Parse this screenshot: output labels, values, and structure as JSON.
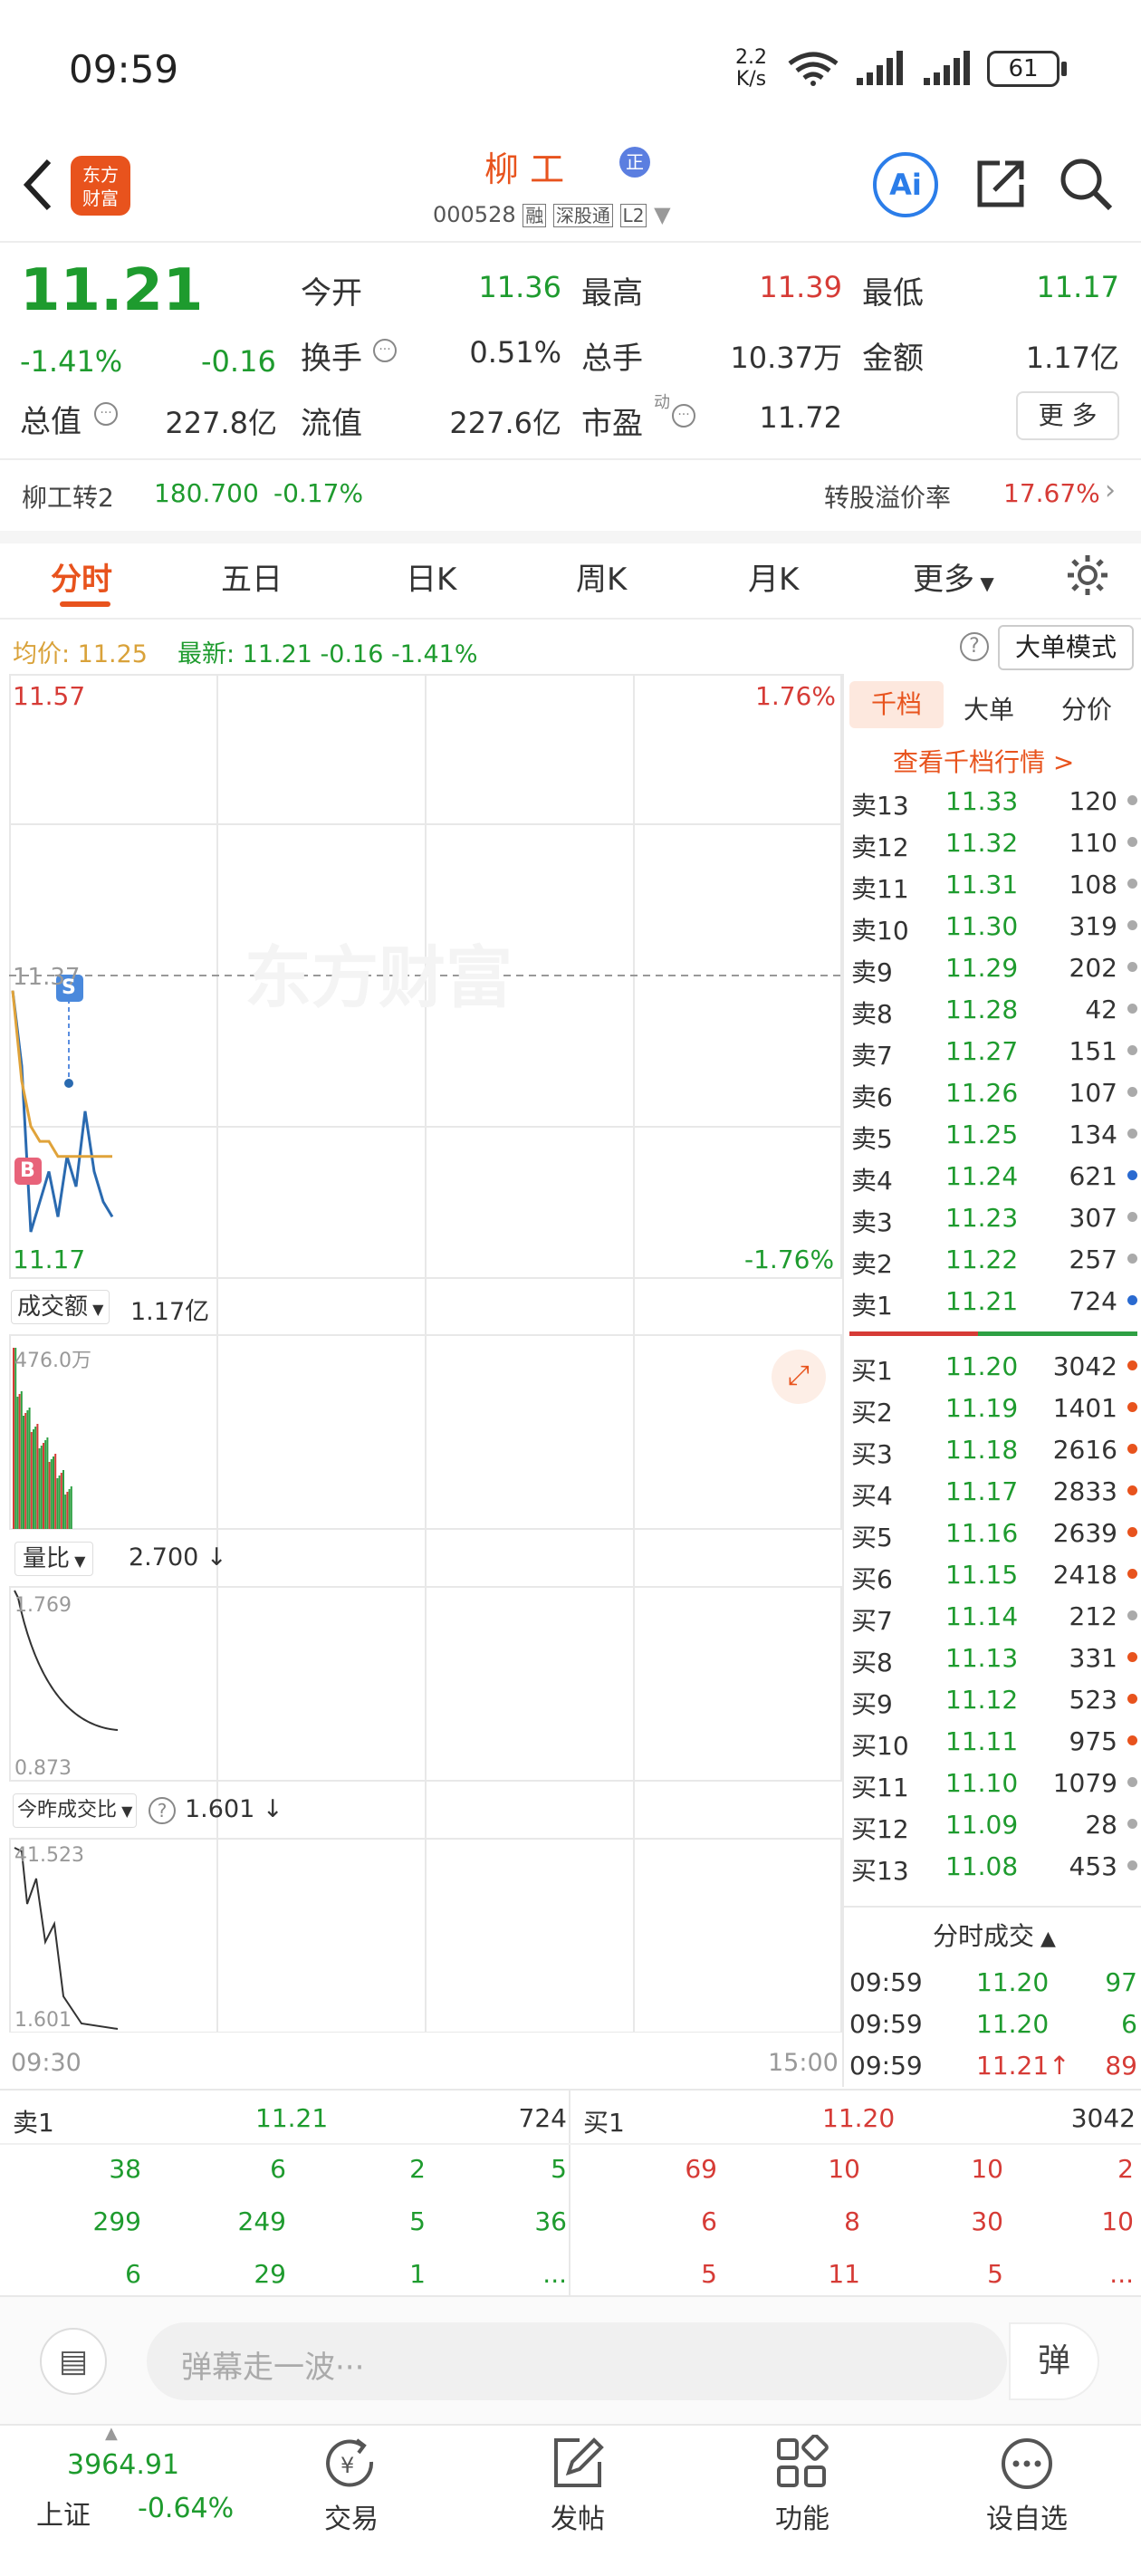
{
  "status": {
    "time": "09:59",
    "speed_top": "2.2",
    "speed_bot": "K/s",
    "battery": "61"
  },
  "header": {
    "logo_line1": "东方",
    "logo_line2": "财富",
    "name": "柳  工",
    "name_badge": "正",
    "code": "000528",
    "tag1": "融",
    "tag2": "深股通",
    "tag3": "L2"
  },
  "quote": {
    "price": "11.21",
    "pct": "-1.41%",
    "chg": "-0.16",
    "open_label": "今开",
    "open": "11.36",
    "high_label": "最高",
    "high": "11.39",
    "low_label": "最低",
    "low": "11.17",
    "turnover_label": "换手",
    "turnover": "0.51%",
    "volume_label": "总手",
    "volume": "10.37万",
    "amount_label": "金额",
    "amount": "1.17亿",
    "mcap_label": "总值",
    "mcap": "227.8亿",
    "float_label": "流值",
    "float": "227.6亿",
    "pe_label": "市盈",
    "pe_sup": "动",
    "pe": "11.72",
    "more": "更 多"
  },
  "bond": {
    "name": "柳工转2",
    "price": "180.700",
    "pct": "-0.17%",
    "premium_label": "转股溢价率",
    "premium": "17.67%"
  },
  "tabs": [
    "分时",
    "五日",
    "日K",
    "周K",
    "月K",
    "更多"
  ],
  "chart_header": {
    "avg": "均价: 11.25",
    "latest": "最新: 11.21 -0.16 -1.41%",
    "mode_button": "大单模式"
  },
  "chart": {
    "top_price": "11.57",
    "top_pct": "1.76%",
    "mid_price": "11.37",
    "bottom_price": "11.17",
    "bottom_pct": "-1.76%",
    "watermark": "东方财富",
    "sell_marker": "S",
    "buy_marker": "B",
    "vol_label": "成交额",
    "vol_value": "1.17亿",
    "vol_max": "476.0万",
    "ratio_label": "量比",
    "ratio_value": "2.700 ↓",
    "ratio_max": "1.769",
    "ratio_min": "0.873",
    "yday_label": "今昨成交比",
    "yday_value": "1.601 ↓",
    "yday_max": "41.523",
    "yday_min": "1.601",
    "time_start": "09:30",
    "time_end": "15:00"
  },
  "chart_data": {
    "type": "line",
    "title": "",
    "x": [
      "09:30",
      "09:59"
    ],
    "ylim": [
      11.17,
      11.57
    ],
    "series": [
      {
        "name": "",
        "values": [
          11.36,
          11.31,
          11.2,
          11.22,
          11.24,
          11.21,
          11.25,
          11.23,
          11.28,
          11.24,
          11.22,
          11.21
        ]
      },
      {
        "name": "",
        "values": [
          11.36,
          11.3,
          11.27,
          11.26,
          11.26,
          11.25,
          11.25,
          11.25,
          11.25,
          11.25,
          11.25,
          11.25
        ]
      }
    ]
  },
  "orderbook": {
    "tabs": [
      "千档",
      "大单",
      "分价"
    ],
    "link": "查看千档行情 >",
    "asks": [
      [
        "卖13",
        "11.33",
        "120"
      ],
      [
        "卖12",
        "11.32",
        "110"
      ],
      [
        "卖11",
        "11.31",
        "108"
      ],
      [
        "卖10",
        "11.30",
        "319"
      ],
      [
        "卖9",
        "11.29",
        "202"
      ],
      [
        "卖8",
        "11.28",
        "42"
      ],
      [
        "卖7",
        "11.27",
        "151"
      ],
      [
        "卖6",
        "11.26",
        "107"
      ],
      [
        "卖5",
        "11.25",
        "134"
      ],
      [
        "卖4",
        "11.24",
        "621"
      ],
      [
        "卖3",
        "11.23",
        "307"
      ],
      [
        "卖2",
        "11.22",
        "257"
      ],
      [
        "卖1",
        "11.21",
        "724"
      ]
    ],
    "bids": [
      [
        "买1",
        "11.20",
        "3042"
      ],
      [
        "买2",
        "11.19",
        "1401"
      ],
      [
        "买3",
        "11.18",
        "2616"
      ],
      [
        "买4",
        "11.17",
        "2833"
      ],
      [
        "买5",
        "11.16",
        "2639"
      ],
      [
        "买6",
        "11.15",
        "2418"
      ],
      [
        "买7",
        "11.14",
        "212"
      ],
      [
        "买8",
        "11.13",
        "331"
      ],
      [
        "买9",
        "11.12",
        "523"
      ],
      [
        "买10",
        "11.11",
        "975"
      ],
      [
        "买11",
        "11.10",
        "1079"
      ],
      [
        "买12",
        "11.09",
        "28"
      ],
      [
        "买13",
        "11.08",
        "453"
      ]
    ]
  },
  "ticks": {
    "title": "分时成交",
    "rows": [
      [
        "09:59",
        "11.20",
        "97"
      ],
      [
        "09:59",
        "11.20",
        "6"
      ],
      [
        "09:59",
        "11.21",
        "89"
      ]
    ]
  },
  "queue": {
    "sell_label": "卖1",
    "sell_price": "11.21",
    "sell_vol": "724",
    "buy_label": "买1",
    "buy_price": "11.20",
    "buy_vol": "3042",
    "sell_rows": [
      [
        "38",
        "6",
        "2",
        "5"
      ],
      [
        "299",
        "249",
        "5",
        "36"
      ],
      [
        "6",
        "29",
        "1",
        "..."
      ]
    ],
    "buy_rows": [
      [
        "69",
        "10",
        "10",
        "2"
      ],
      [
        "6",
        "8",
        "30",
        "10"
      ],
      [
        "5",
        "11",
        "5",
        "..."
      ]
    ]
  },
  "comment": {
    "placeholder": "弹幕走一波···",
    "send": "弹"
  },
  "bottomnav": {
    "index_value": "3964.91",
    "index_name": "上证",
    "index_pct": "-0.64%",
    "items": [
      "交易",
      "发帖",
      "功能",
      "设自选"
    ]
  }
}
